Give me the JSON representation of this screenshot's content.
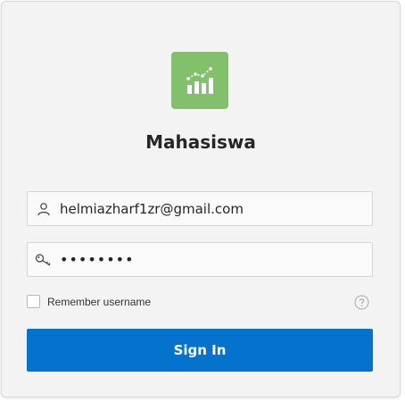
{
  "app": {
    "title": "Mahasiswa",
    "icon": "chart-growth-icon",
    "icon_color": "#82c06b"
  },
  "login": {
    "username_value": "helmiazharf1zr@gmail.com",
    "password_value": "••••••••",
    "remember_label": "Remember username",
    "remember_checked": false,
    "signin_label": "Sign In",
    "signin_color": "#0572ce"
  }
}
